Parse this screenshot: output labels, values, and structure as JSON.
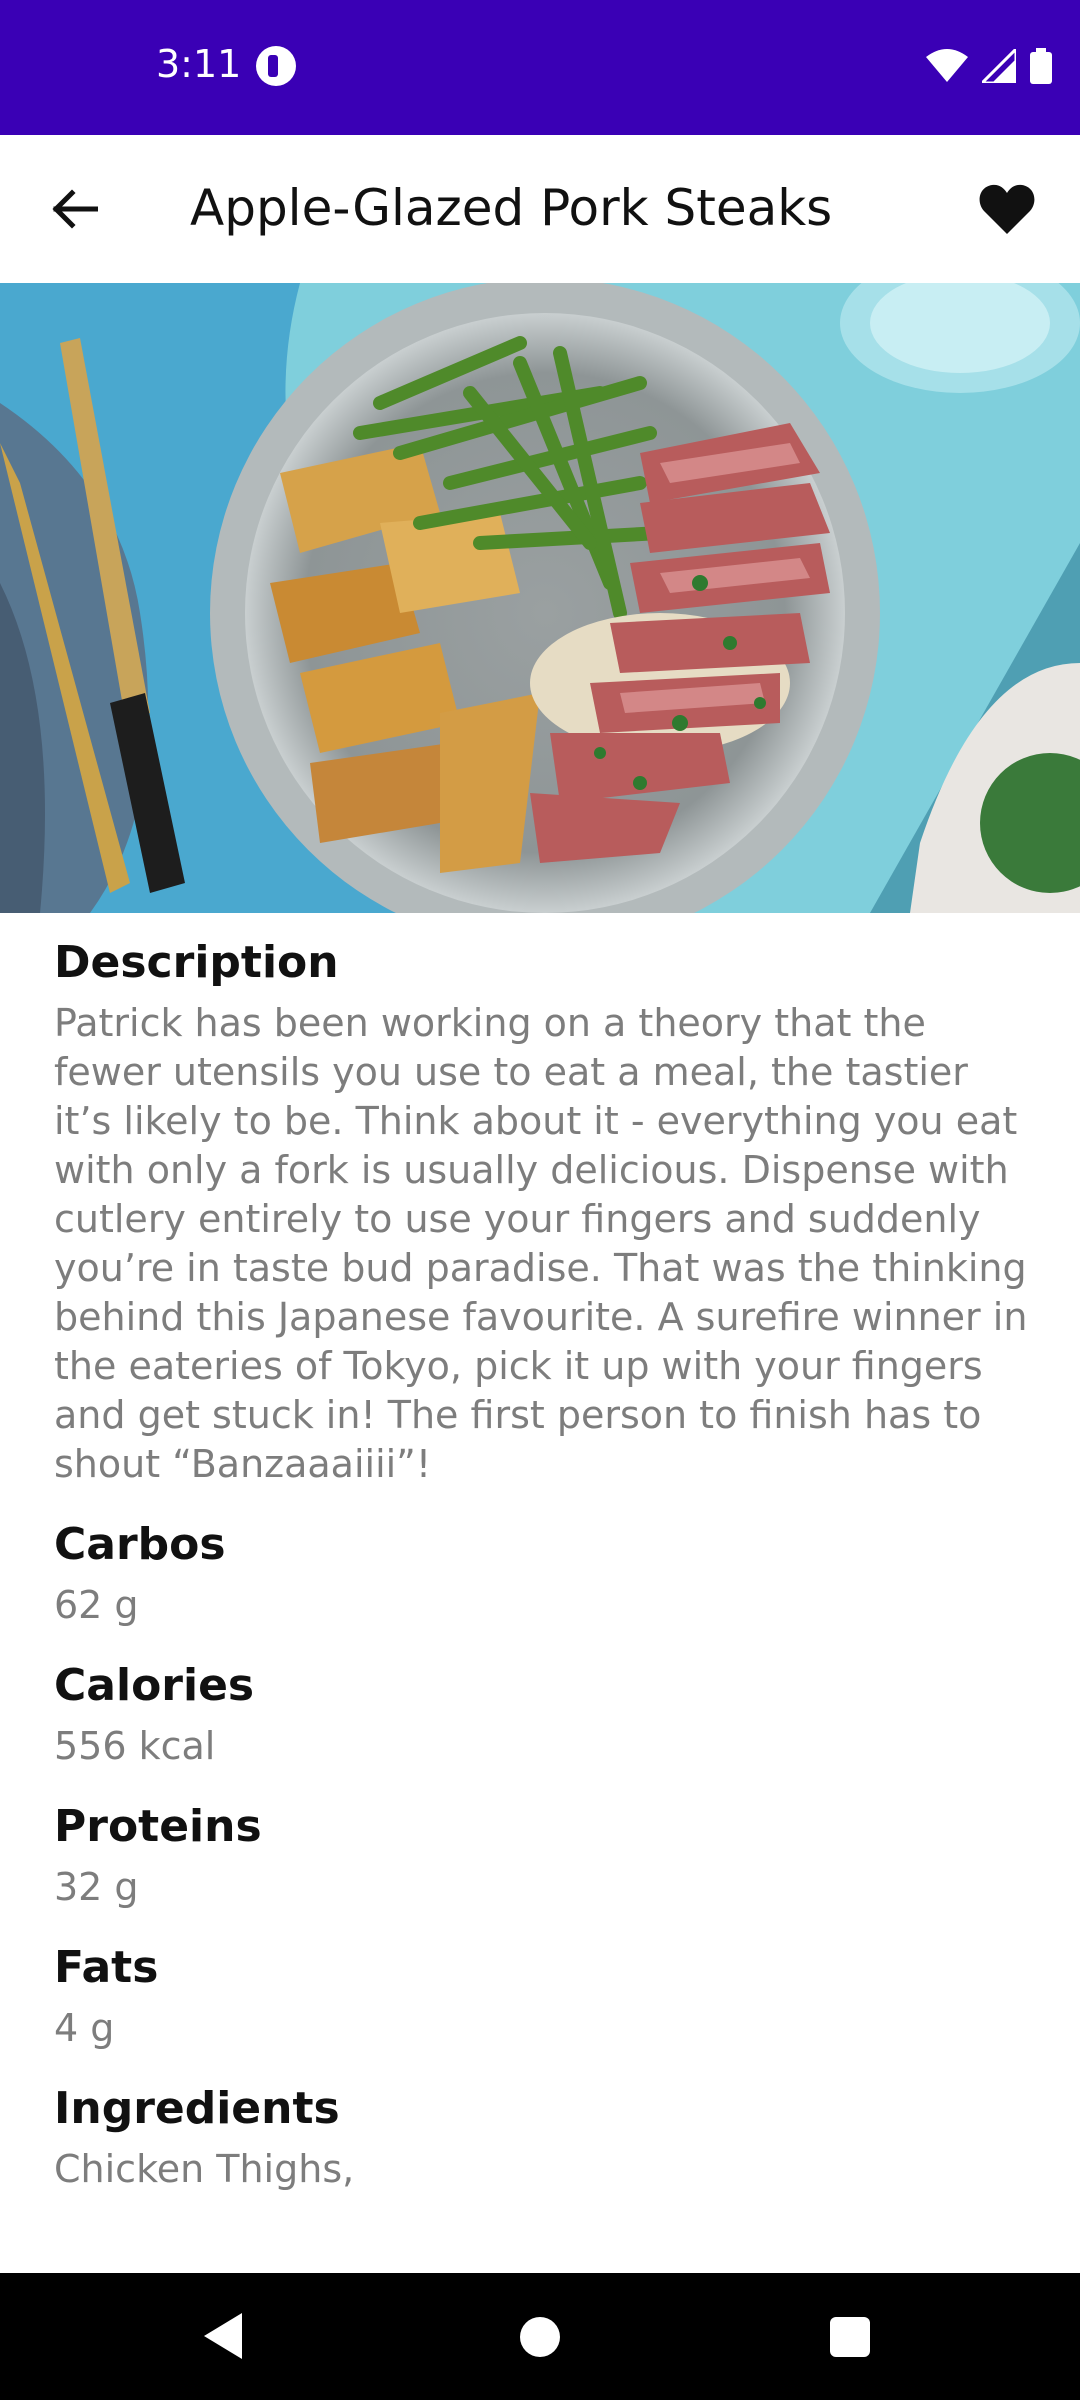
{
  "status_bar": {
    "time": "3:11",
    "icons": [
      "app-notification-icon",
      "wifi-icon",
      "signal-icon",
      "battery-icon"
    ]
  },
  "app_bar": {
    "title": "Apple-Glazed Pork Steaks",
    "back_icon": "arrow-back-icon",
    "favorite_icon": "heart-icon"
  },
  "hero": {
    "alt": "Plate with roasted potato wedges, green beans and sliced pork steak with sauce"
  },
  "details": {
    "description_heading": "Description",
    "description": "Patrick has been working on a theory that the fewer utensils you use to eat a meal, the tastier it’s likely to be. Think about it - everything you eat with only a fork is usually delicious. Dispense with cutlery entirely to use your fingers and suddenly you’re in taste bud paradise. That was the thinking behind this Japanese favourite. A surefire winner in the eateries of Tokyo, pick it up with your fingers and get stuck in! The first person to finish has to shout “Banzaaaiiii”!",
    "carbos_heading": "Carbos",
    "carbos": "62 g",
    "calories_heading": "Calories",
    "calories": "556 kcal",
    "proteins_heading": "Proteins",
    "proteins": "32 g",
    "fats_heading": "Fats",
    "fats": "4 g",
    "ingredients_heading": "Ingredients",
    "ingredients": "Chicken Thighs,"
  },
  "colors": {
    "status_bar": "#3a00b5",
    "heading_text": "#111111",
    "body_text": "#7d7d7d",
    "nav_bar": "#000000"
  }
}
